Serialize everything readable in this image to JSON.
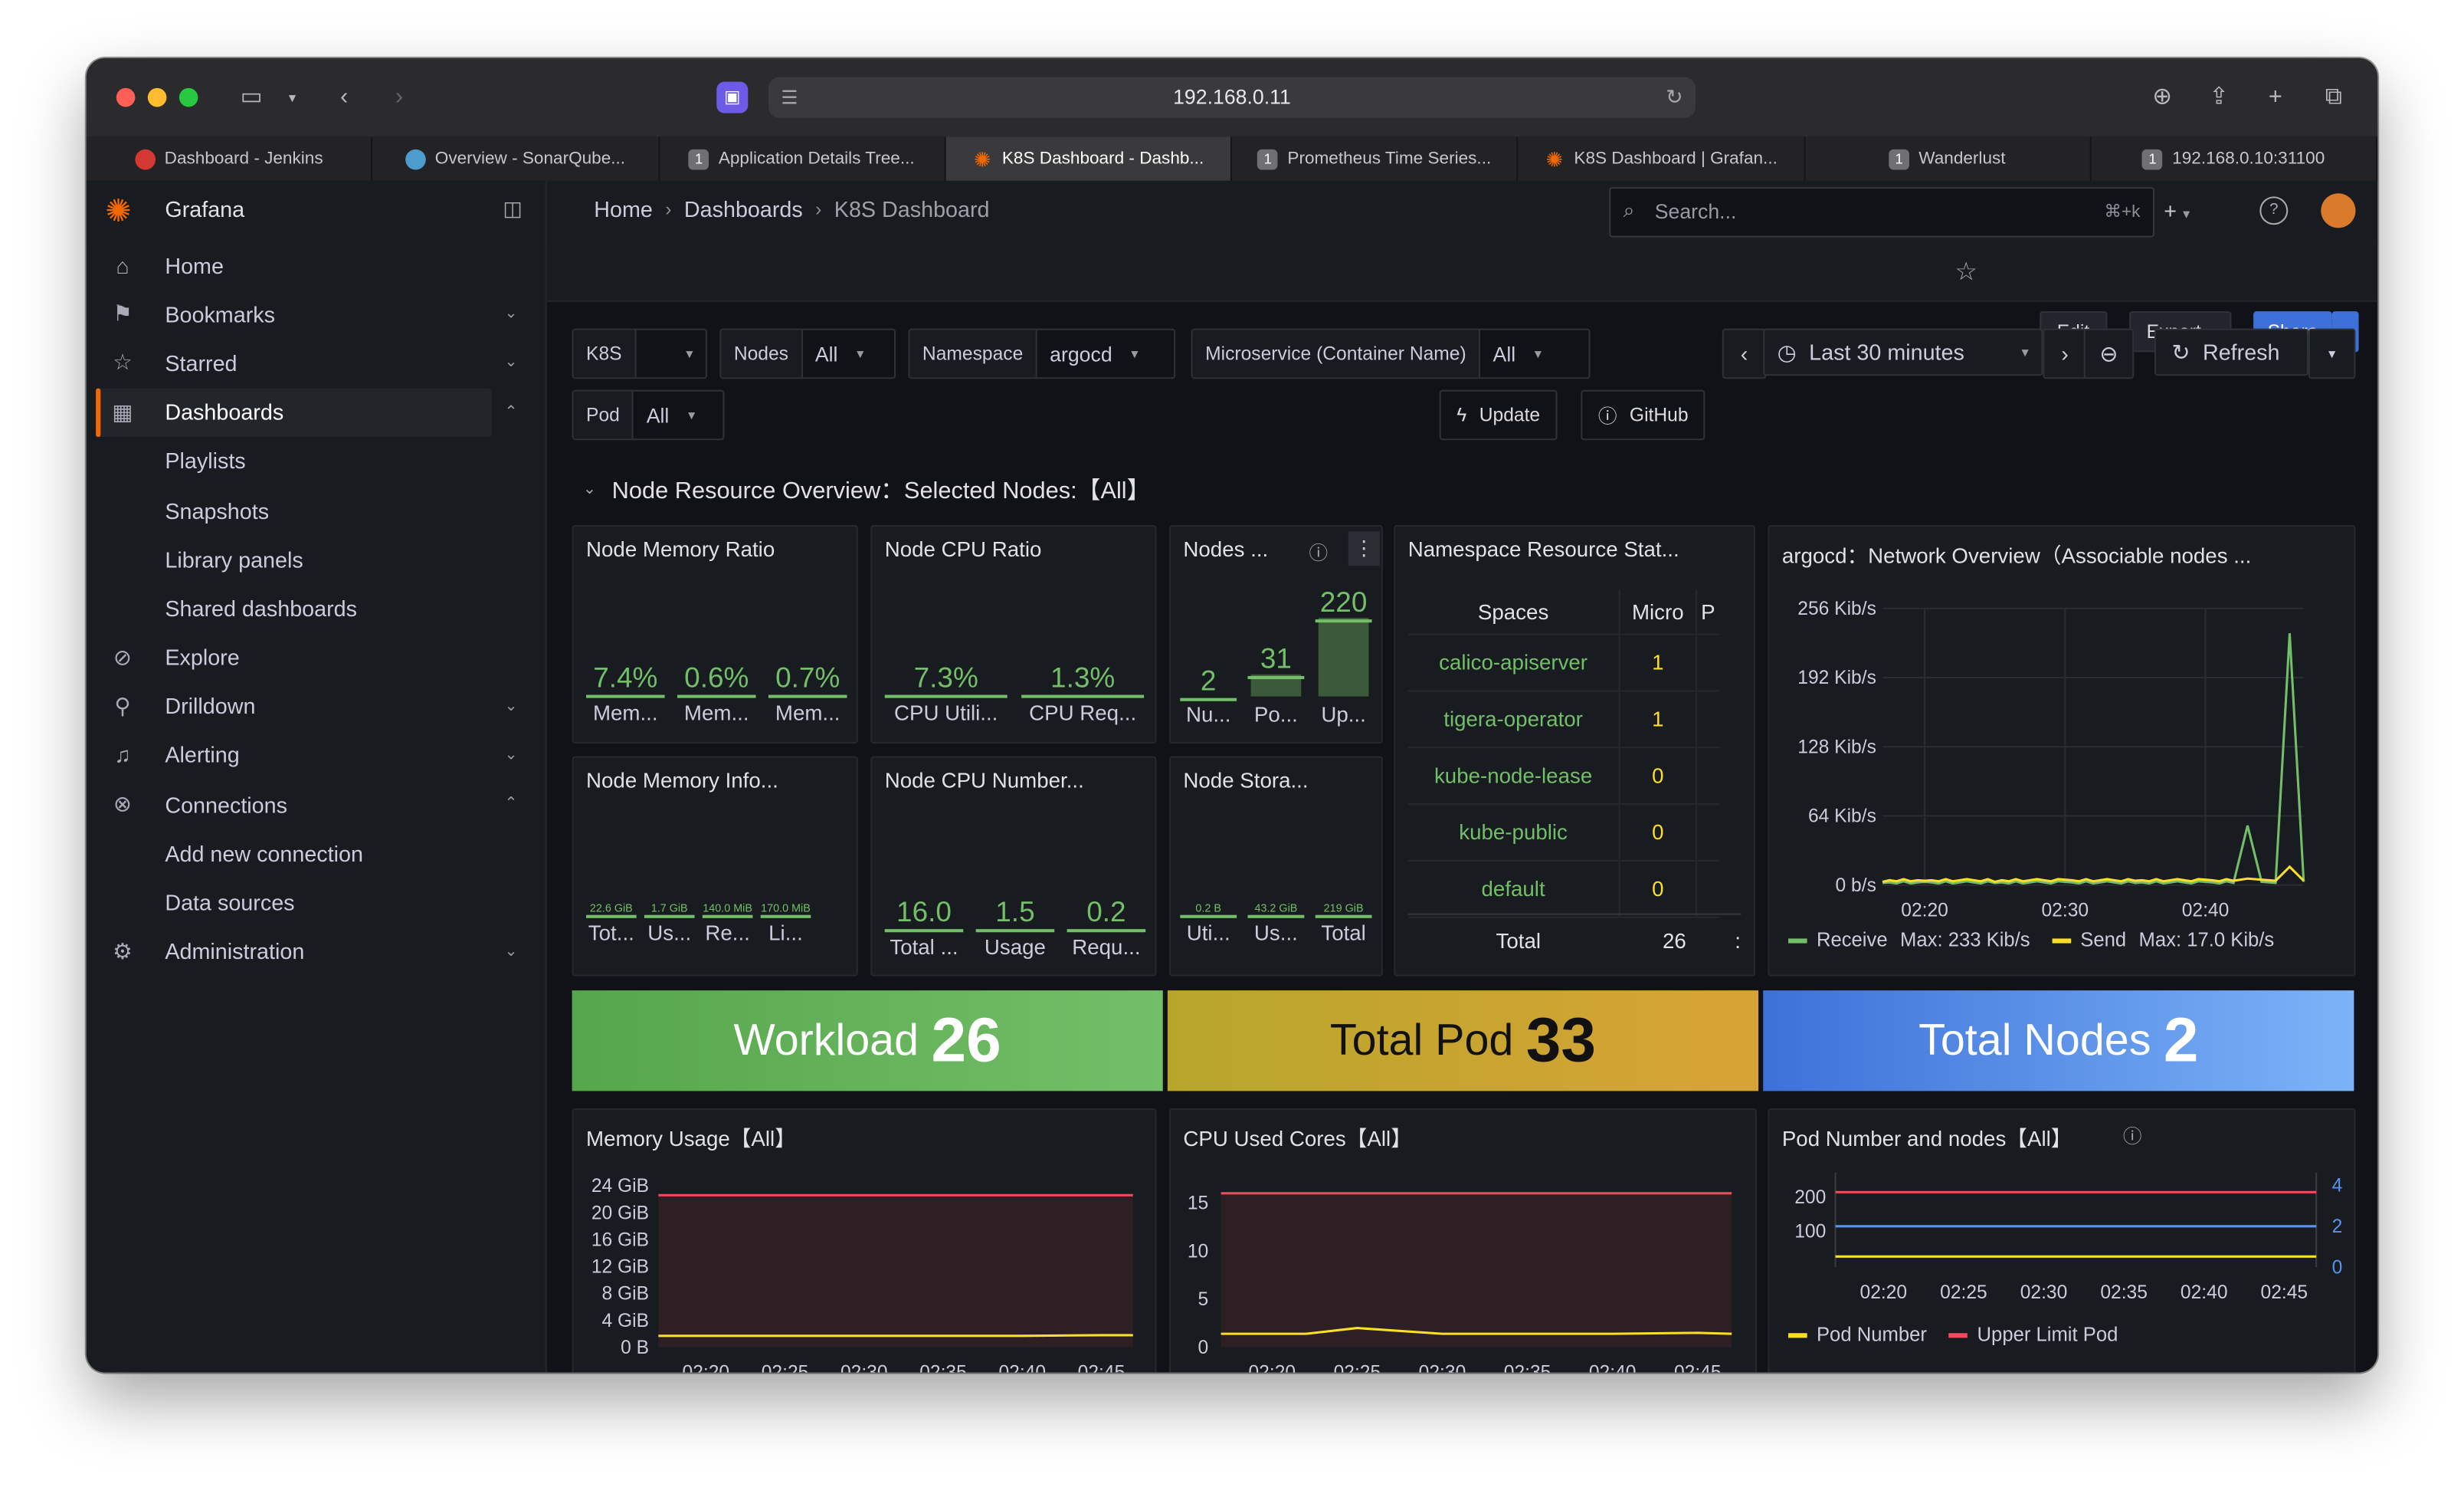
{
  "browser": {
    "url": "192.168.0.11",
    "tabs": [
      {
        "title": "Dashboard - Jenkins",
        "icon": "jenkins-icon"
      },
      {
        "title": "Overview - SonarQube...",
        "icon": "sonarqube-icon"
      },
      {
        "title": "Application Details Tree...",
        "icon": "badge-icon"
      },
      {
        "title": "K8S Dashboard - Dashb...",
        "icon": "grafana-icon",
        "active": true
      },
      {
        "title": "Prometheus Time Series...",
        "icon": "badge-icon"
      },
      {
        "title": "K8S Dashboard | Grafan...",
        "icon": "grafana-icon"
      },
      {
        "title": "Wanderlust",
        "icon": "badge-icon"
      },
      {
        "title": "192.168.0.10:31100",
        "icon": "badge-icon"
      }
    ]
  },
  "grafana": {
    "brand": "Grafana",
    "search_placeholder": "Search...",
    "search_shortcut": "⌘+k",
    "breadcrumb": [
      "Home",
      "Dashboards",
      "K8S Dashboard"
    ],
    "toolbar": {
      "edit": "Edit",
      "export": "Export",
      "share": "Share"
    }
  },
  "sidebar": {
    "items": [
      {
        "label": "Home",
        "icon": "home-icon"
      },
      {
        "label": "Bookmarks",
        "icon": "bookmark-icon",
        "chev": "down"
      },
      {
        "label": "Starred",
        "icon": "star-icon",
        "chev": "down"
      },
      {
        "label": "Dashboards",
        "icon": "grid-icon",
        "chev": "up",
        "active": true
      },
      {
        "label": "Playlists",
        "sub": true
      },
      {
        "label": "Snapshots",
        "sub": true
      },
      {
        "label": "Library panels",
        "sub": true
      },
      {
        "label": "Shared dashboards",
        "sub": true
      },
      {
        "label": "Explore",
        "icon": "compass-icon"
      },
      {
        "label": "Drilldown",
        "icon": "drilldown-icon",
        "chev": "down"
      },
      {
        "label": "Alerting",
        "icon": "bell-icon",
        "chev": "down"
      },
      {
        "label": "Connections",
        "icon": "connections-icon",
        "chev": "up"
      },
      {
        "label": "Add new connection",
        "sub": true
      },
      {
        "label": "Data sources",
        "sub": true
      },
      {
        "label": "Administration",
        "icon": "gear-icon",
        "chev": "down"
      }
    ]
  },
  "variables": {
    "k8s": {
      "label": "K8S",
      "value": ""
    },
    "nodes": {
      "label": "Nodes",
      "value": "All"
    },
    "namespace": {
      "label": "Namespace",
      "value": "argocd"
    },
    "microservice": {
      "label": "Microservice (Container Name)",
      "value": "All"
    },
    "pod": {
      "label": "Pod",
      "value": "All"
    }
  },
  "time": {
    "range": "Last 30 minutes",
    "refresh": "Refresh"
  },
  "links": {
    "update": "Update",
    "github": "GitHub"
  },
  "row_title": "Node Resource Overview：Selected Nodes:【All】",
  "panels": {
    "mem_ratio": {
      "title": "Node Memory Ratio",
      "stats": [
        {
          "v": "7.4%",
          "l": "Mem..."
        },
        {
          "v": "0.6%",
          "l": "Mem..."
        },
        {
          "v": "0.7%",
          "l": "Mem..."
        }
      ]
    },
    "cpu_ratio": {
      "title": "Node CPU Ratio",
      "stats": [
        {
          "v": "7.3%",
          "l": "CPU Utili..."
        },
        {
          "v": "1.3%",
          "l": "CPU Req..."
        }
      ]
    },
    "nodes": {
      "title": "Nodes ...",
      "stats": [
        {
          "v": "2",
          "l": "Nu..."
        },
        {
          "v": "31",
          "l": "Po..."
        },
        {
          "v": "220",
          "l": "Up..."
        }
      ]
    },
    "mem_info": {
      "title": "Node Memory Info...",
      "stats": [
        {
          "v": "22.6 GiB",
          "l": "Tot..."
        },
        {
          "v": "1.7 GiB",
          "l": "Us..."
        },
        {
          "v": "140.0 MiB",
          "l": "Re..."
        },
        {
          "v": "170.0 MiB",
          "l": "Li..."
        }
      ]
    },
    "cpu_num": {
      "title": "Node CPU Number...",
      "stats": [
        {
          "v": "16.0",
          "l": "Total ..."
        },
        {
          "v": "1.5",
          "l": "Usage"
        },
        {
          "v": "0.2",
          "l": "Requ..."
        }
      ]
    },
    "storage": {
      "title": "Node Stora...",
      "stats": [
        {
          "v": "0.2 B",
          "l": "Uti..."
        },
        {
          "v": "43.2 GiB",
          "l": "Us..."
        },
        {
          "v": "219 GiB",
          "l": "Total"
        }
      ]
    },
    "ns_stats": {
      "title": "Namespace Resource Stat...",
      "headers": [
        "Spaces",
        "Micro",
        "P"
      ],
      "rows": [
        {
          "name": "calico-apiserver",
          "v": "1"
        },
        {
          "name": "tigera-operator",
          "v": "1"
        },
        {
          "name": "kube-node-lease",
          "v": "0"
        },
        {
          "name": "kube-public",
          "v": "0"
        },
        {
          "name": "default",
          "v": "0"
        }
      ],
      "total_label": "Total",
      "total_value": "26"
    },
    "network": {
      "title": "argocd：Network Overview（Associable nodes ...",
      "legend": [
        {
          "name": "Receive",
          "stat": "Max: 233 Kib/s",
          "color": "#73bf69"
        },
        {
          "name": "Send",
          "stat": "Max: 17.0 Kib/s",
          "color": "#fade2a"
        }
      ]
    },
    "big": [
      {
        "title": "Workload",
        "value": "26",
        "color": "#56a64b"
      },
      {
        "title": "Total Pod",
        "value": "33",
        "color": "#c9a723"
      },
      {
        "title": "Total Nodes",
        "value": "2",
        "color": "#5794f2"
      }
    ],
    "memory_usage": {
      "title": "Memory Usage【All】"
    },
    "cpu_used": {
      "title": "CPU Used Cores【All】"
    },
    "pod_nodes": {
      "title": "Pod Number and nodes【All】",
      "legend": [
        {
          "name": "Pod Number",
          "color": "#fade2a"
        },
        {
          "name": "Upper Limit Pod",
          "color": "#f2495c"
        }
      ]
    }
  },
  "chart_data": [
    {
      "type": "line",
      "title": "argocd：Network Overview（Associable nodes ...",
      "x": [
        "02:17",
        "02:20",
        "02:25",
        "02:30",
        "02:35",
        "02:40",
        "02:42",
        "02:43",
        "02:44",
        "02:45",
        "02:46",
        "02:47"
      ],
      "xticks": [
        "02:20",
        "02:30",
        "02:40"
      ],
      "yticks": [
        "0 b/s",
        "64 Kib/s",
        "128 Kib/s",
        "192 Kib/s",
        "256 Kib/s"
      ],
      "ylim": [
        0,
        256
      ],
      "series": [
        {
          "name": "Receive",
          "color": "#73bf69",
          "values": [
            2,
            3,
            2,
            3,
            2,
            3,
            2,
            55,
            3,
            2,
            233,
            3
          ]
        },
        {
          "name": "Send",
          "color": "#fade2a",
          "values": [
            3,
            4,
            3,
            5,
            4,
            5,
            4,
            6,
            5,
            4,
            17,
            4
          ]
        }
      ]
    },
    {
      "type": "line",
      "title": "Memory Usage【All】",
      "x": [
        "02:17",
        "02:20",
        "02:25",
        "02:30",
        "02:35",
        "02:40",
        "02:45",
        "02:47"
      ],
      "xticks": [
        "02:20",
        "02:25",
        "02:30",
        "02:35",
        "02:40",
        "02:45"
      ],
      "yticks": [
        "0 B",
        "4 GiB",
        "8 GiB",
        "12 GiB",
        "16 GiB",
        "20 GiB",
        "24 GiB"
      ],
      "ylim": [
        0,
        25
      ],
      "series": [
        {
          "name": "Total",
          "color": "#f2495c",
          "values": [
            22.6,
            22.6,
            22.6,
            22.6,
            22.6,
            22.6,
            22.6,
            22.6
          ]
        },
        {
          "name": "Used",
          "color": "#fade2a",
          "values": [
            1.7,
            1.7,
            1.7,
            1.7,
            1.7,
            1.7,
            1.8,
            1.8
          ]
        }
      ]
    },
    {
      "type": "line",
      "title": "CPU Used Cores【All】",
      "x": [
        "02:17",
        "02:20",
        "02:22",
        "02:25",
        "02:30",
        "02:35",
        "02:40",
        "02:45",
        "02:47"
      ],
      "xticks": [
        "02:20",
        "02:25",
        "02:30",
        "02:35",
        "02:40",
        "02:45"
      ],
      "yticks": [
        "0",
        "5",
        "10",
        "15"
      ],
      "ylim": [
        0,
        16.5
      ],
      "series": [
        {
          "name": "Total",
          "color": "#f2495c",
          "values": [
            16,
            16,
            16,
            16,
            16,
            16,
            16,
            16,
            16
          ]
        },
        {
          "name": "Used",
          "color": "#fade2a",
          "values": [
            1.4,
            1.4,
            1.4,
            2.0,
            1.4,
            1.4,
            1.4,
            1.5,
            1.4
          ]
        }
      ]
    },
    {
      "type": "line",
      "title": "Pod Number and nodes【All】",
      "x": [
        "02:17",
        "02:20",
        "02:25",
        "02:30",
        "02:35",
        "02:40",
        "02:45",
        "02:47"
      ],
      "xticks": [
        "02:20",
        "02:25",
        "02:30",
        "02:35",
        "02:40",
        "02:45"
      ],
      "yticks_left": [
        "100",
        "200"
      ],
      "yticks_right": [
        "0",
        "2",
        "4"
      ],
      "series": [
        {
          "name": "Pod Number",
          "color": "#fade2a",
          "values": [
            31,
            31,
            31,
            31,
            31,
            31,
            31,
            31
          ]
        },
        {
          "name": "Upper Limit Pod",
          "color": "#f2495c",
          "values": [
            220,
            220,
            220,
            220,
            220,
            220,
            220,
            220
          ]
        },
        {
          "name": "Nodes",
          "color": "#5794f2",
          "values": [
            2,
            2,
            2,
            2,
            2,
            2,
            2,
            2
          ]
        }
      ]
    }
  ]
}
